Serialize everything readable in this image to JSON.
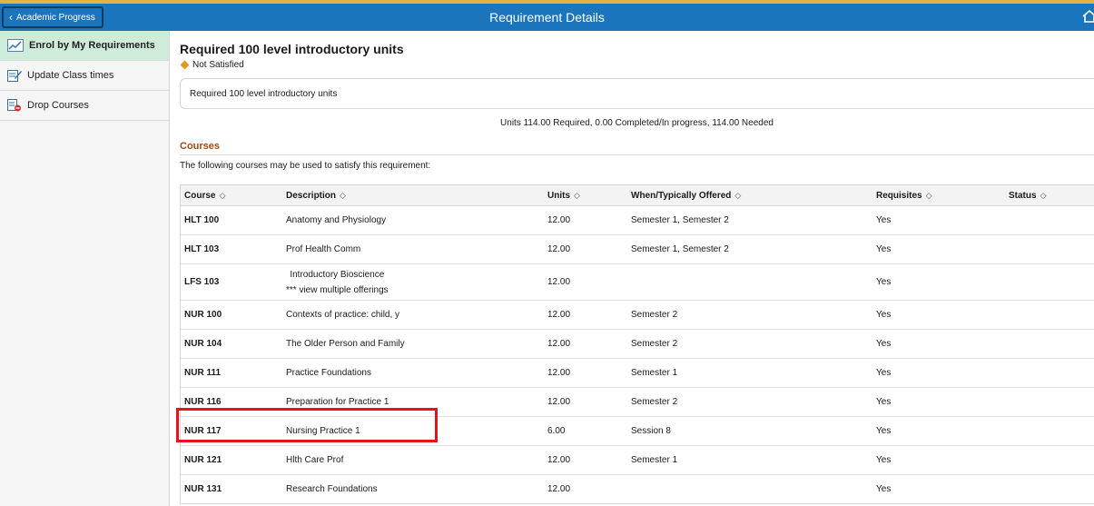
{
  "header": {
    "back_label": "Academic Progress",
    "title": "Requirement Details",
    "home_icon": "home-icon"
  },
  "sidebar": {
    "items": [
      {
        "label": "Enrol by My Requirements",
        "icon": "chart-icon",
        "active": true
      },
      {
        "label": "Update Class times",
        "icon": "edit-icon"
      },
      {
        "label": "Drop Courses",
        "icon": "drop-icon"
      }
    ]
  },
  "requirement": {
    "title": "Required 100 level introductory units",
    "status": "Not Satisfied",
    "description": "Required 100 level introductory units",
    "units_summary": "Units  114.00 Required, 0.00 Completed/In progress, 114.00 Needed"
  },
  "courses": {
    "heading": "Courses",
    "note": "The following courses may be used to satisfy this requirement:",
    "columns": [
      "Course",
      "Description",
      "Units",
      "When/Typically Offered",
      "Requisites",
      "Status"
    ],
    "sort_icon": "◇",
    "rows": [
      {
        "course": "HLT 100",
        "description": "Anatomy and Physiology",
        "units": "12.00",
        "offered": "Semester 1, Semester 2",
        "requisites": "Yes",
        "status": ""
      },
      {
        "course": "HLT 103",
        "description": "Prof Health Comm",
        "units": "12.00",
        "offered": "Semester 1, Semester 2",
        "requisites": "Yes",
        "status": ""
      },
      {
        "course": "LFS 103",
        "description": "Introductory Bioscience",
        "description_link": "*** view multiple offerings",
        "units": "12.00",
        "offered": "",
        "requisites": "Yes",
        "status": ""
      },
      {
        "course": "NUR 100",
        "description": "Contexts of practice: child, y",
        "units": "12.00",
        "offered": "Semester 2",
        "requisites": "Yes",
        "status": ""
      },
      {
        "course": "NUR 104",
        "description": "The Older Person and Family",
        "units": "12.00",
        "offered": "Semester 2",
        "requisites": "Yes",
        "status": ""
      },
      {
        "course": "NUR 111",
        "description": "Practice Foundations",
        "units": "12.00",
        "offered": "Semester 1",
        "requisites": "Yes",
        "status": ""
      },
      {
        "course": "NUR 116",
        "description": "Preparation for Practice 1",
        "units": "12.00",
        "offered": "Semester 2",
        "requisites": "Yes",
        "status": ""
      },
      {
        "course": "NUR 117",
        "description": "Nursing Practice 1",
        "units": "6.00",
        "offered": "Session 8",
        "requisites": "Yes",
        "status": ""
      },
      {
        "course": "NUR 121",
        "description": "Hlth Care Prof",
        "units": "12.00",
        "offered": "Semester 1",
        "requisites": "Yes",
        "status": ""
      },
      {
        "course": "NUR 131",
        "description": "Research Foundations",
        "units": "12.00",
        "offered": "",
        "requisites": "Yes",
        "status": ""
      }
    ]
  },
  "colors": {
    "header_bg": "#1b75bc",
    "header_accent": "#e6b042",
    "sidebar_active": "#ceecd9",
    "status_diamond": "#e7961f",
    "highlight": "#e8121b",
    "section_heading": "#9c4a10"
  }
}
